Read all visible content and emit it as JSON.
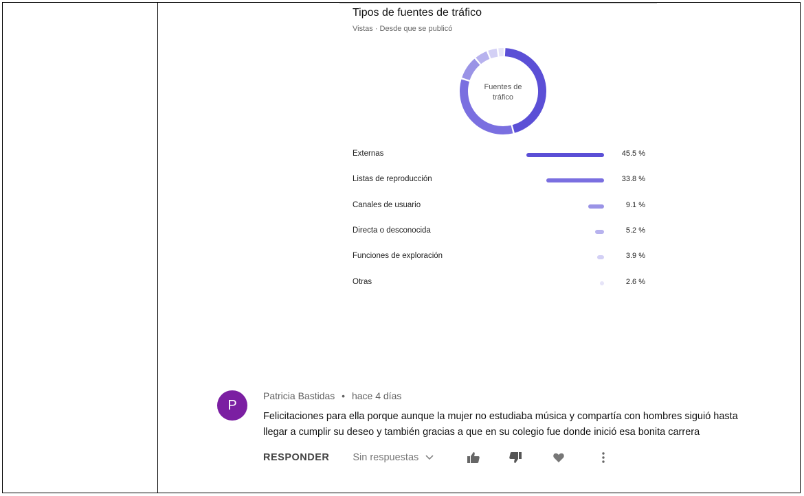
{
  "analytics": {
    "title": "Tipos de fuentes de tráfico",
    "subtitle": "Vistas · Desde que se publicó",
    "donut_label_line1": "Fuentes de",
    "donut_label_line2": "tráfico",
    "sources": [
      {
        "label": "Externas",
        "percent_text": "45.5 %",
        "value": 45.5,
        "color": "#5b4fd6"
      },
      {
        "label": "Listas de reproducción",
        "percent_text": "33.8 %",
        "value": 33.8,
        "color": "#7a6fe0"
      },
      {
        "label": "Canales de usuario",
        "percent_text": "9.1 %",
        "value": 9.1,
        "color": "#9a93e6"
      },
      {
        "label": "Directa o desconocida",
        "percent_text": "5.2 %",
        "value": 5.2,
        "color": "#b7b2ee"
      },
      {
        "label": "Funciones de exploración",
        "percent_text": "3.9 %",
        "value": 3.9,
        "color": "#d3d0f5"
      },
      {
        "label": "Otras",
        "percent_text": "2.6 %",
        "value": 2.6,
        "color": "#e6e4f8"
      }
    ]
  },
  "comment": {
    "avatar_letter": "P",
    "avatar_color": "#7b1fa2",
    "author": "Patricia Bastidas",
    "separator": "•",
    "time": "hace 4 días",
    "text_line1": "Felicitaciones para ella porque aunque la mujer no estudiaba música y compartía con hombres siguió hasta",
    "text_line2": "llegar a cumplir su deseo y también gracias a que en su colegio fue donde inició esa bonita carrera",
    "reply_label": "RESPONDER",
    "replies_label": "Sin respuestas"
  }
}
